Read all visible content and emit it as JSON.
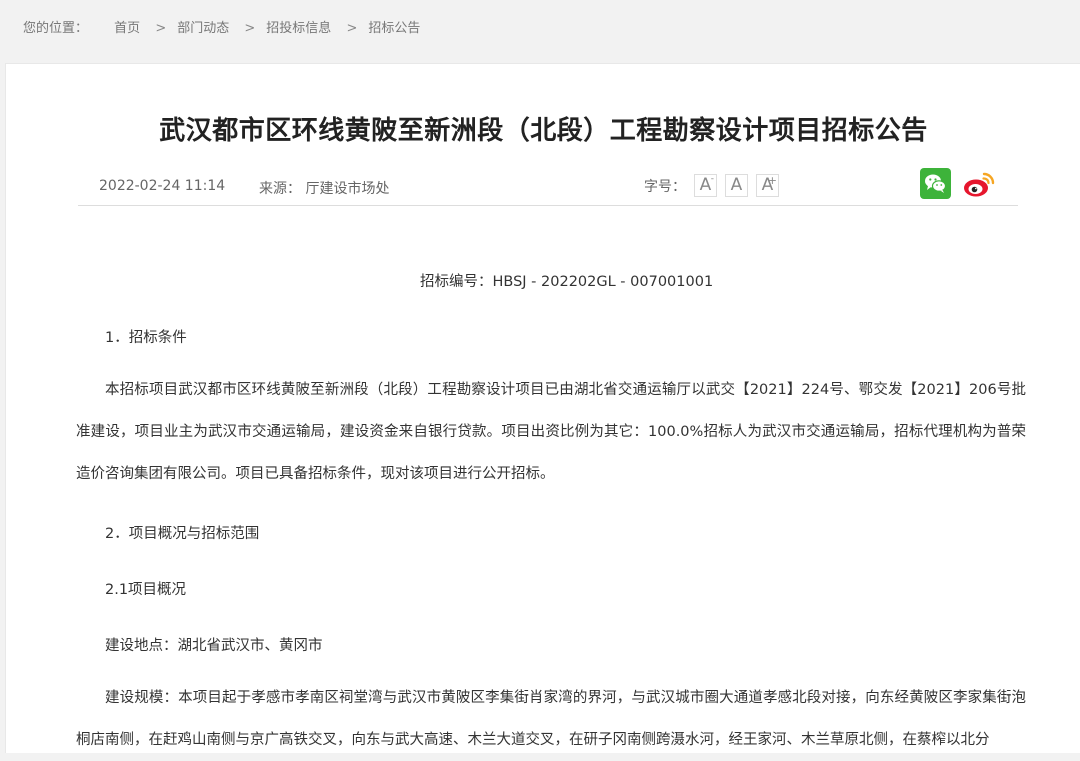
{
  "breadcrumb": {
    "prefix": "您的位置：",
    "items": [
      "首页",
      "部门动态",
      "招投标信息",
      "招标公告"
    ],
    "separator": ">"
  },
  "article": {
    "title": "武汉都市区环线黄陂至新洲段（北段）工程勘察设计项目招标公告",
    "date": "2022-02-24 11:14",
    "source": "来源： 厅建设市场处",
    "fontsize_label": "字号：",
    "fontsize_buttons": [
      "A",
      "A",
      "A"
    ],
    "share": [
      "wechat-icon",
      "weibo-icon"
    ]
  },
  "body": {
    "code": "招标编号：HBSJ - 202202GL - 007001001",
    "sec1": "1．招标条件",
    "p1": "本招标项目武汉都市区环线黄陂至新洲段（北段）工程勘察设计项目已由湖北省交通运输厅以武交【2021】224号、鄂交发【2021】206号批准建设，项目业主为武汉市交通运输局，建设资金来自银行贷款。项目出资比例为其它：100.0%招标人为武汉市交通运输局，招标代理机构为普荣造价咨询集团有限公司。项目已具备招标条件，现对该项目进行公开招标。",
    "sec2": "2．项目概况与招标范围",
    "sec21": "2.1项目概况",
    "location": "建设地点：湖北省武汉市、黄冈市",
    "p2": "建设规模：本项目起于孝感市孝南区祠堂湾与武汉市黄陂区李集街肖家湾的界河，与武汉城市圈大通道孝感北段对接，向东经黄陂区李家集街泡桐店南侧，在赶鸡山南侧与京广高铁交叉，向东与武大高速、木兰大道交叉，在研子冈南侧跨滠水河，经王家河、木兰草原北侧，在蔡榨以北分"
  },
  "colors": {
    "wechat": "#3db33a",
    "weibo": "#e6162d"
  }
}
